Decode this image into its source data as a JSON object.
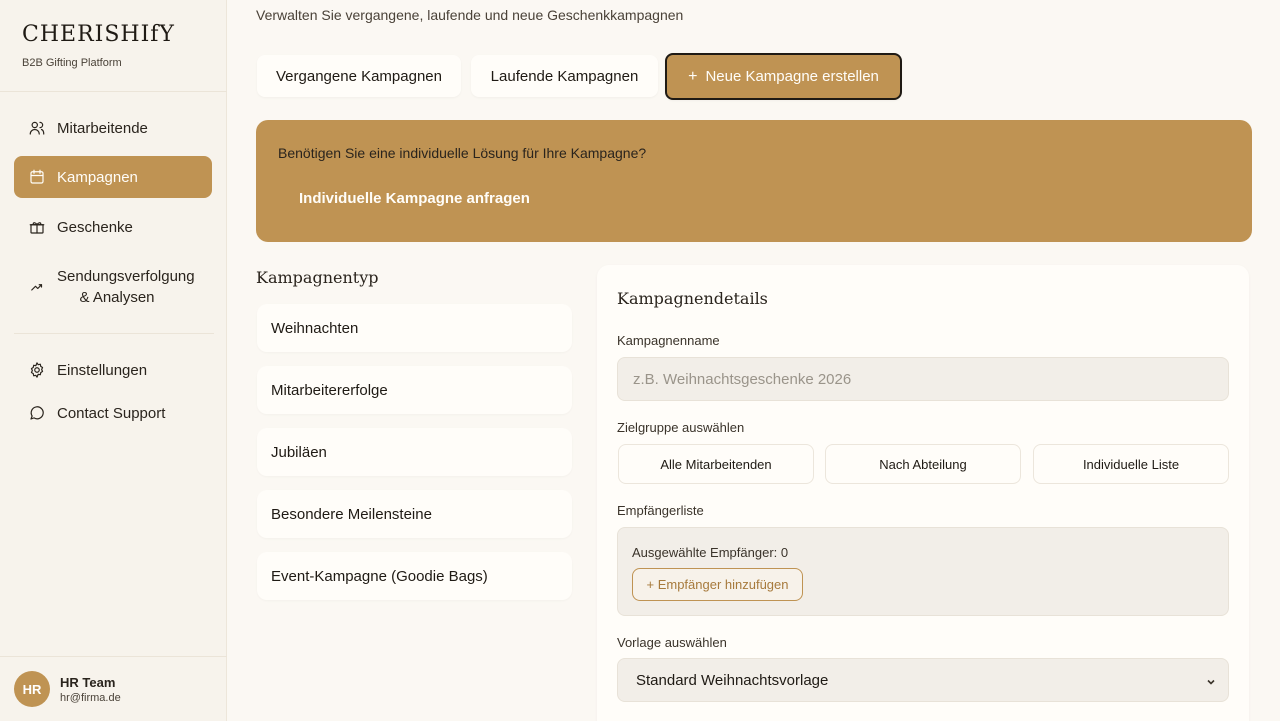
{
  "brand": {
    "logo": "CHERISHIfY",
    "tagline": "B2B Gifting Platform"
  },
  "sidebar": {
    "items": [
      {
        "label": "Mitarbeitende",
        "icon": "users-icon"
      },
      {
        "label": "Kampagnen",
        "icon": "calendar-icon",
        "active": true
      },
      {
        "label": "Geschenke",
        "icon": "gift-icon"
      },
      {
        "label": "Sendungsverfolgung & Analysen",
        "icon": "trending-up-icon"
      },
      {
        "label": "Einstellungen",
        "icon": "gear-icon"
      },
      {
        "label": "Contact Support",
        "icon": "message-icon"
      }
    ],
    "user": {
      "initials": "HR",
      "name": "HR Team",
      "email": "hr@firma.de"
    }
  },
  "main": {
    "subtitle": "Verwalten Sie vergangene, laufende und neue Geschenkkampagnen",
    "tabs": {
      "past": "Vergangene Kampagnen",
      "running": "Laufende Kampagnen",
      "new_plus": "+",
      "new": "Neue Kampagne erstellen"
    },
    "banner": {
      "question": "Benötigen Sie eine individuelle Lösung für Ihre Kampagne?",
      "link": "Individuelle Kampagne anfragen"
    },
    "campaign_types": {
      "title": "Kampagnentyp",
      "items": [
        "Weihnachten",
        "Mitarbeitererfolge",
        "Jubiläen",
        "Besondere Meilensteine",
        "Event-Kampagne (Goodie Bags)"
      ]
    },
    "details": {
      "title": "Kampagnendetails",
      "name_label": "Kampagnenname",
      "name_placeholder": "z.B. Weihnachtsgeschenke 2026",
      "target_label": "Zielgruppe auswählen",
      "target_options": [
        "Alle Mitarbeitenden",
        "Nach Abteilung",
        "Individuelle Liste"
      ],
      "recipients_label": "Empfängerliste",
      "recipients_count": "Ausgewählte Empfänger: 0",
      "add_recipients": "+ Empfänger hinzufügen",
      "template_label": "Vorlage auswählen",
      "template_value": "Standard Weihnachtsvorlage"
    }
  },
  "colors": {
    "accent": "#bf9353",
    "background": "#fbf8f3",
    "sidebar": "#f7f3ec"
  }
}
